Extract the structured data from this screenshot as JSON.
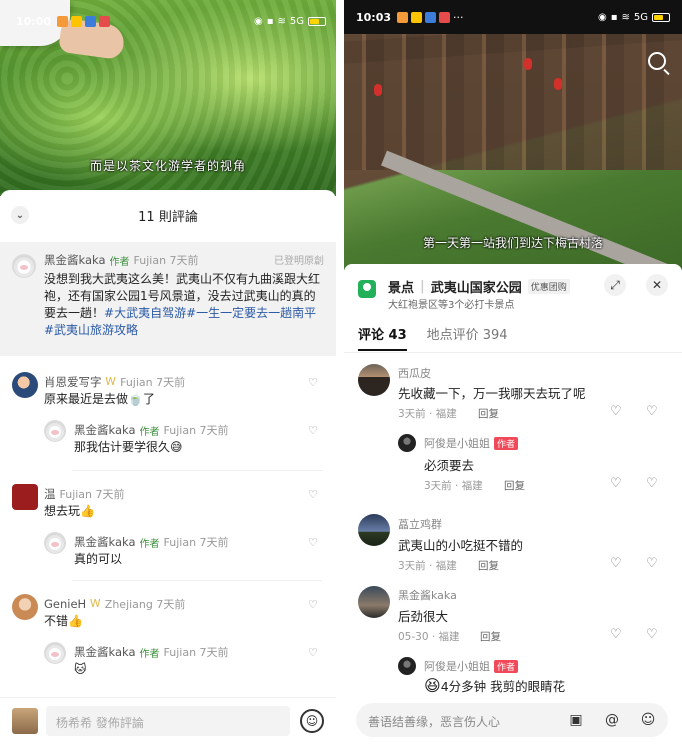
{
  "left": {
    "status": {
      "time": "10:00",
      "signal": "5G"
    },
    "video_subtitle": "而是以茶文化游学者的视角",
    "comments_header": "11 則評論",
    "pinned": {
      "name": "黑金酱kaka",
      "author_tag": "作者",
      "location_time": "Fujian 7天前",
      "right_tag": "已登明原創",
      "text_plain": "没想到我大武夷这么美！武夷山不仅有九曲溪跟大红袍，还有国家公园1号风景道，没去过武夷山的真的要去一趟！",
      "tag1": "#大武夷自驾游",
      "tag2": "#一生一定要去一趟南平",
      "tag3": "#武夷山旅游攻略"
    },
    "comments": [
      {
        "name": "肖恩爱写字",
        "location_time": "Fujian 7天前",
        "text": "原来最近是去做",
        "text_tail": "了",
        "reply": {
          "name": "黑金酱kaka",
          "author_tag": "作者",
          "location_time": "Fujian 7天前",
          "text": "那我估计要学很久"
        }
      },
      {
        "name": "温",
        "location_time": "Fujian 7天前",
        "text": "想去玩",
        "reply": {
          "name": "黑金酱kaka",
          "author_tag": "作者",
          "location_time": "Fujian 7天前",
          "text": "真的可以"
        }
      },
      {
        "name": "GenieH",
        "location_time": "Zhejiang 7天前",
        "text": "不错",
        "reply": {
          "name": "黑金酱kaka",
          "author_tag": "作者",
          "location_time": "Fujian 7天前",
          "text": "🐱"
        }
      }
    ],
    "input_placeholder": "杨希希 發佈評論"
  },
  "right": {
    "status": {
      "time": "10:03",
      "signal": "5G"
    },
    "video_subtitle": "第一天第一站我们到达下梅古村落",
    "poi": {
      "prefix": "景点",
      "name": "武夷山国家公园",
      "badge": "优惠团购",
      "sub": "大红袍景区等3个必打卡景点"
    },
    "tabs": {
      "comments": "评论 43",
      "poi_reviews": "地点评价 394"
    },
    "comments": [
      {
        "name": "西瓜皮",
        "text": "先收藏一下，万一我哪天去玩了呢",
        "meta": "3天前 · 福建",
        "reply_label": "回复",
        "reply": {
          "name": "阿俊是小姐姐",
          "author_tag": "作者",
          "text": "必须要去",
          "meta": "3天前 · 福建",
          "reply_label": "回复"
        }
      },
      {
        "name": "藠立鸡群",
        "text": "武夷山的小吃挺不错的",
        "meta": "3天前 · 福建",
        "reply_label": "回复"
      },
      {
        "name": "黑金酱kaka",
        "text": "后劲很大",
        "meta": "05-30 · 福建",
        "reply_label": "回复",
        "reply": {
          "name": "阿俊是小姐姐",
          "author_tag": "作者",
          "text": "4分多钟 我剪的眼睛花"
        }
      }
    ],
    "input_placeholder": "善语结善缘，恶言伤人心"
  },
  "icons": {
    "heart": "♡",
    "dislike": "♡",
    "emoji": "☺",
    "at": "@",
    "image": "▣",
    "expand": "⤢",
    "close": "✕",
    "collapse": "⌄"
  }
}
